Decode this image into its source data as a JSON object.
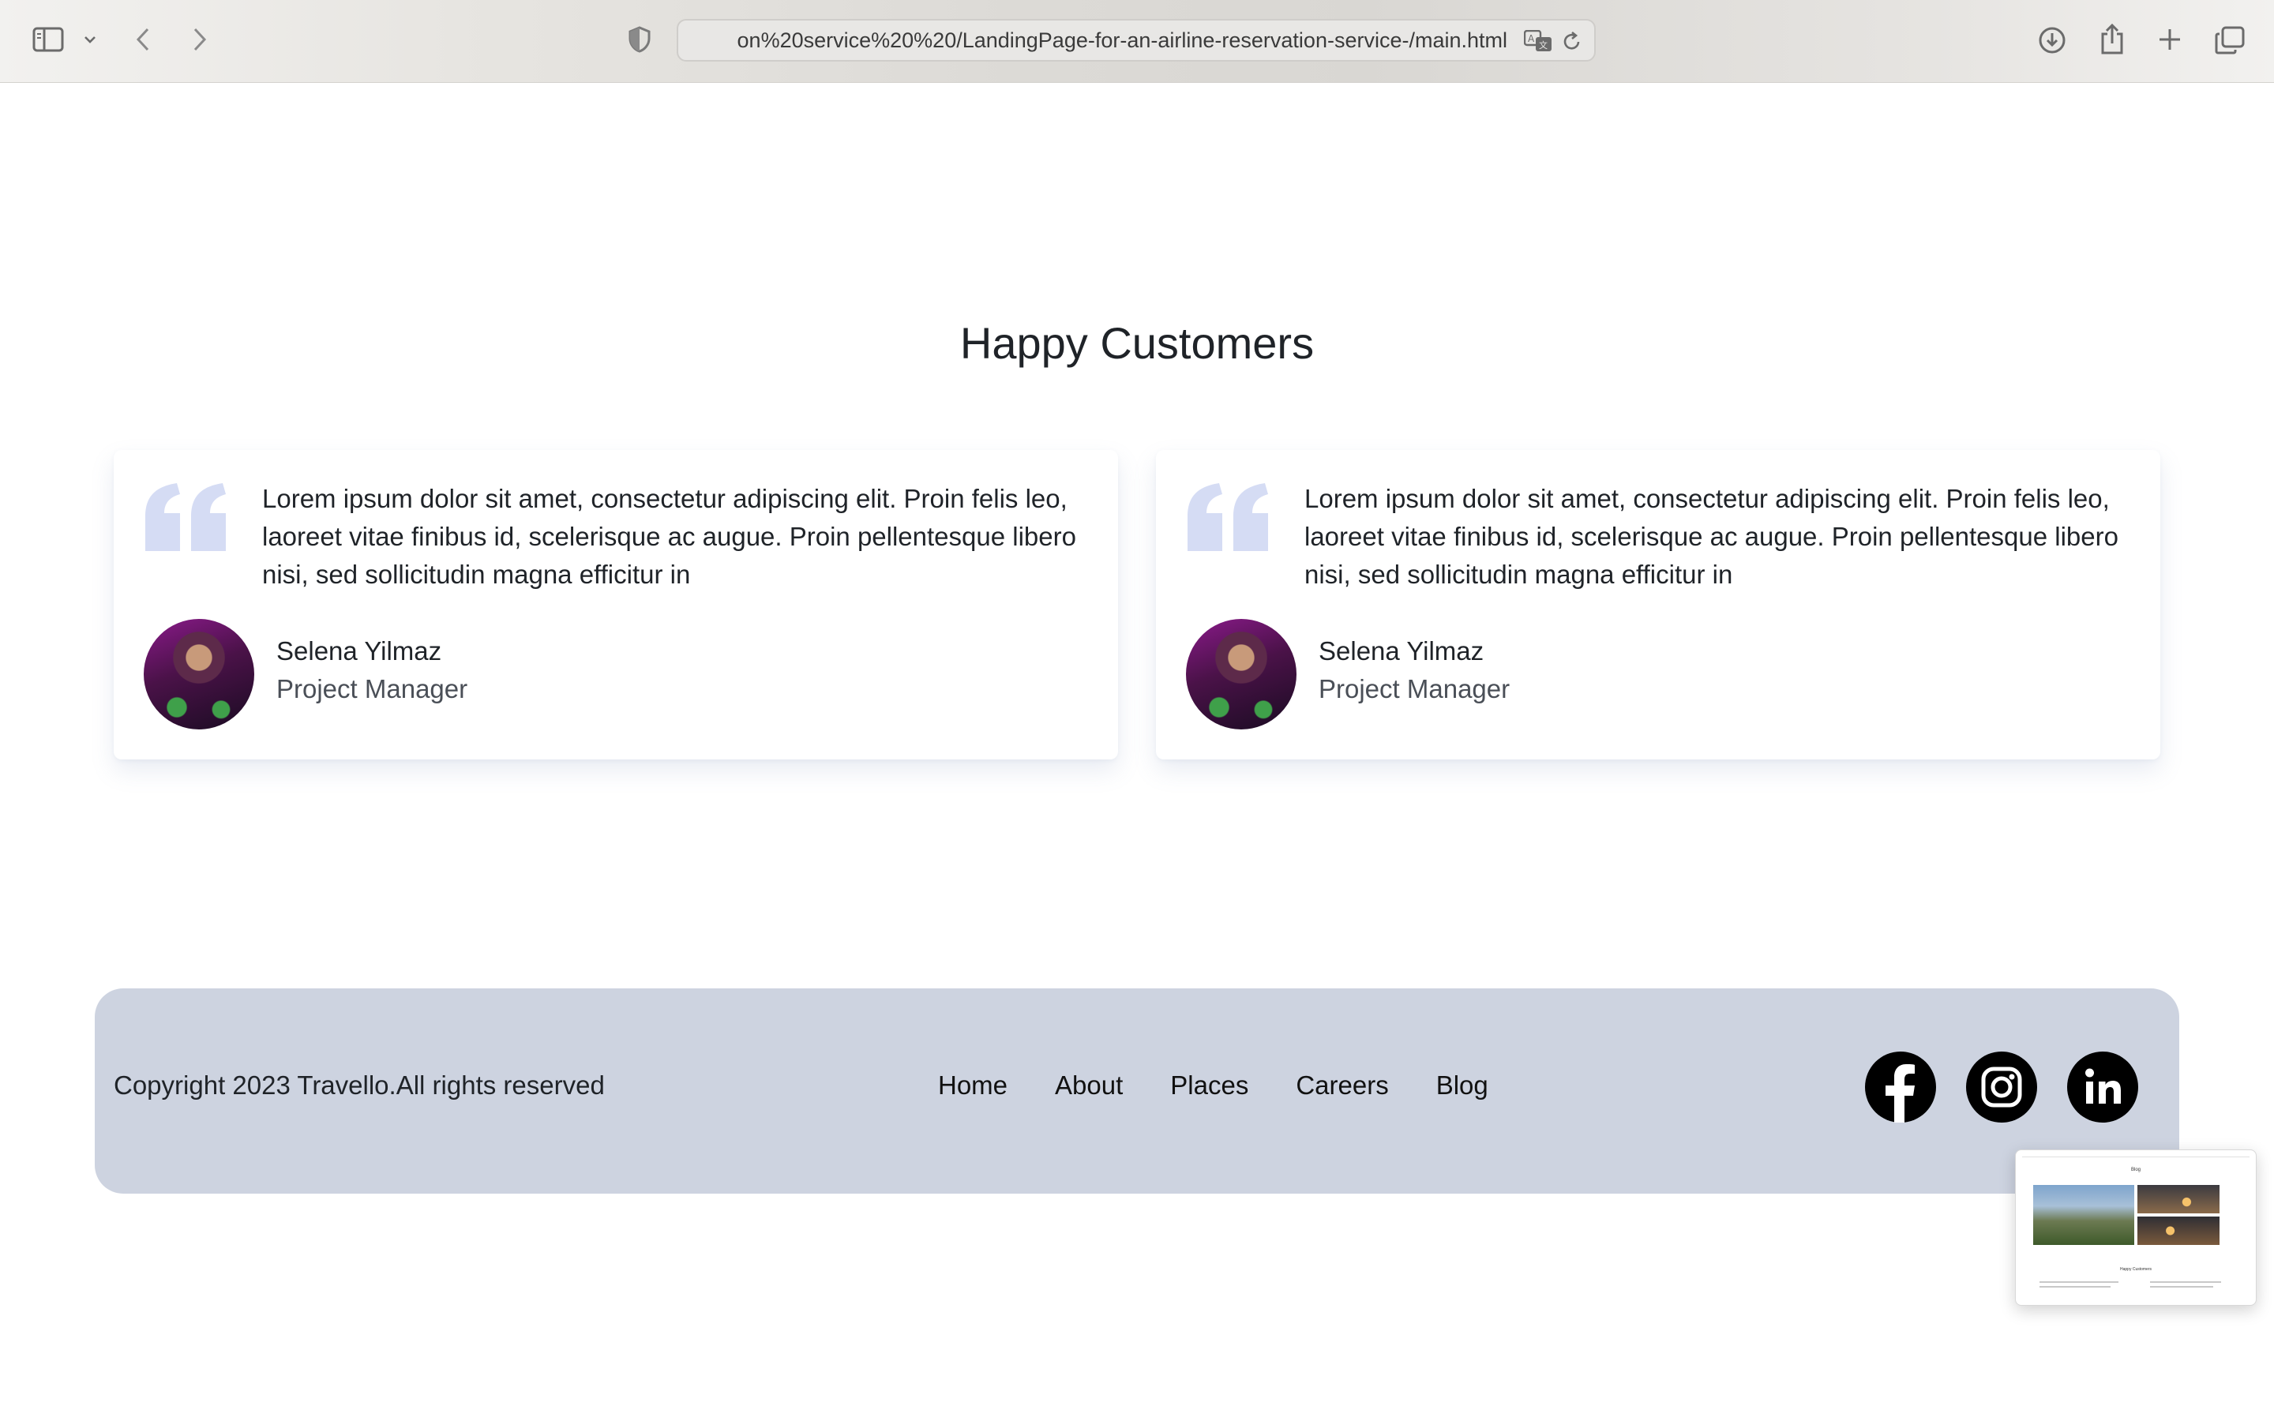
{
  "browser": {
    "url": "on%20service%20%20/LandingPage-for-an-airline-reservation-service-/main.html"
  },
  "testimonials": {
    "title": "Happy Customers",
    "cards": [
      {
        "quote": "Lorem ipsum dolor sit amet, consectetur adipiscing elit. Proin felis leo, laoreet vitae finibus id, scelerisque ac augue. Proin pellentesque libero nisi, sed sollicitudin magna efficitur in",
        "name": "Selena Yilmaz",
        "role": "Project Manager"
      },
      {
        "quote": "Lorem ipsum dolor sit amet, consectetur adipiscing elit. Proin felis leo, laoreet vitae finibus id, scelerisque ac augue. Proin pellentesque libero nisi, sed sollicitudin magna efficitur in",
        "name": "Selena Yilmaz",
        "role": "Project Manager"
      }
    ]
  },
  "footer": {
    "copyright": "Copyright 2023 Travello.All rights reserved",
    "nav": [
      "Home",
      "About",
      "Places",
      "Careers",
      "Blog"
    ],
    "social": [
      "facebook-icon",
      "instagram-icon",
      "linkedin-icon"
    ]
  },
  "thumbnail": {
    "title": "Blog",
    "subtitle": "Happy Customers"
  },
  "colors": {
    "footer_bg": "#cdd3e0",
    "quote_mark": "#d5dcf4",
    "text": "#1f2328"
  }
}
